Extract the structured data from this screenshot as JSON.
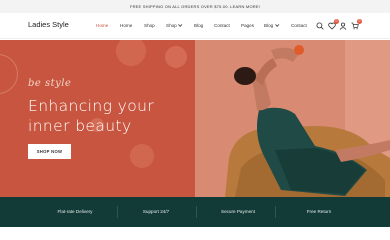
{
  "topbar": {
    "text": "FREE SHIPPING ON ALL ORDERS OVER $75.00. LEARN MORE!"
  },
  "header": {
    "logo": "Ladies Style",
    "nav": [
      {
        "label": "Home",
        "active": true,
        "dropdown": false
      },
      {
        "label": "Home",
        "active": false,
        "dropdown": false
      },
      {
        "label": "Shop",
        "active": false,
        "dropdown": false
      },
      {
        "label": "Shop",
        "active": false,
        "dropdown": true
      },
      {
        "label": "Blog",
        "active": false,
        "dropdown": false
      },
      {
        "label": "Contact",
        "active": false,
        "dropdown": false
      },
      {
        "label": "Pages",
        "active": false,
        "dropdown": false
      },
      {
        "label": "Blog",
        "active": false,
        "dropdown": true
      },
      {
        "label": "Contact",
        "active": false,
        "dropdown": false
      }
    ],
    "icons": {
      "search": "search-icon",
      "wishlist": "heart-icon",
      "account": "user-icon",
      "cart": "cart-icon"
    },
    "wishlist_count": "0",
    "cart_count": "0"
  },
  "hero": {
    "script": "be style",
    "heading_line1": "Enhancing your",
    "heading_line2": "inner beauty",
    "button": "SHOP NOW"
  },
  "features": [
    {
      "label": "Flat-rate Delivery"
    },
    {
      "label": "Support 24/7"
    },
    {
      "label": "Secure Payment"
    },
    {
      "label": "Free Return"
    }
  ],
  "colors": {
    "accent": "#c8553f",
    "features_bg": "#123b38",
    "badge": "#e5533c"
  }
}
